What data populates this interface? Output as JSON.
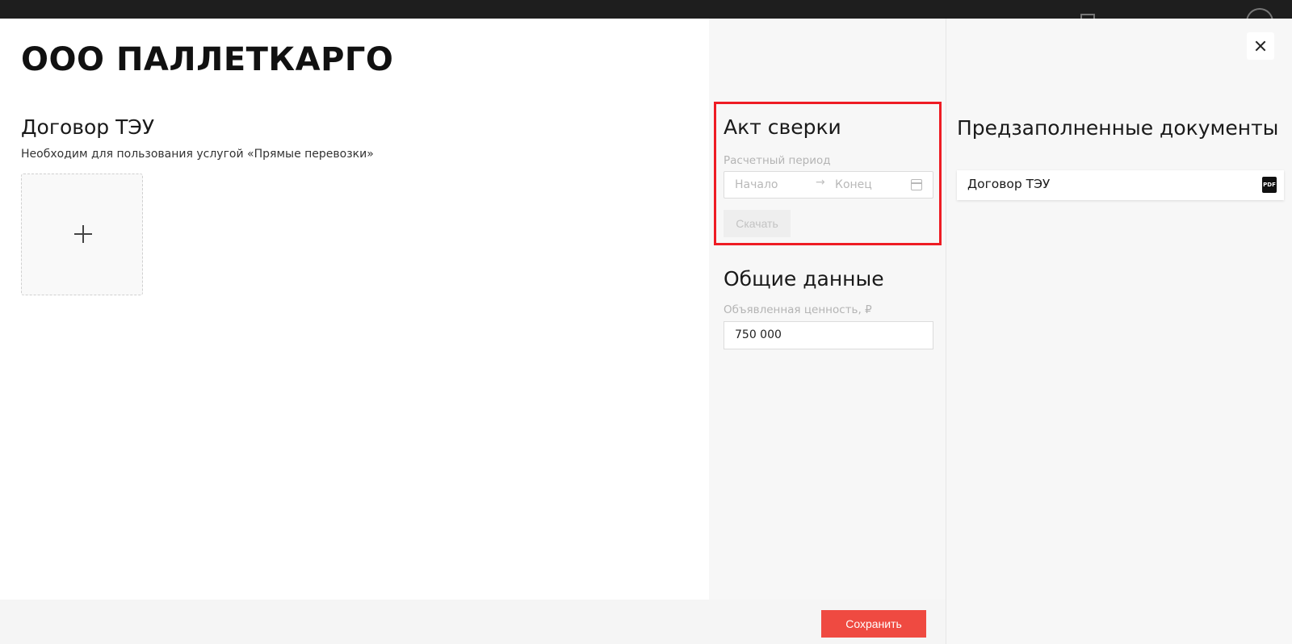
{
  "company": {
    "title": "ООО ПАЛЛЕТКАРГО"
  },
  "teu": {
    "title": "Договор ТЭУ",
    "description": "Необходим для пользования услугой «Прямые перевозки»"
  },
  "reconciliation": {
    "title": "Акт сверки",
    "period_label": "Расчетный период",
    "start_placeholder": "Начало",
    "end_placeholder": "Конец",
    "arrow": "→",
    "download_label": "Скачать"
  },
  "general": {
    "title": "Общие данные",
    "value_label": "Объявленная ценность, ₽",
    "value": "750 000"
  },
  "prefilled": {
    "title": "Предзаполненные документы",
    "documents": [
      {
        "name": "Договор ТЭУ",
        "badge": "PDF"
      }
    ]
  },
  "footer": {
    "save_label": "Сохранить"
  },
  "colors": {
    "accent": "#ef4a41",
    "highlight": "#ee1c24"
  }
}
